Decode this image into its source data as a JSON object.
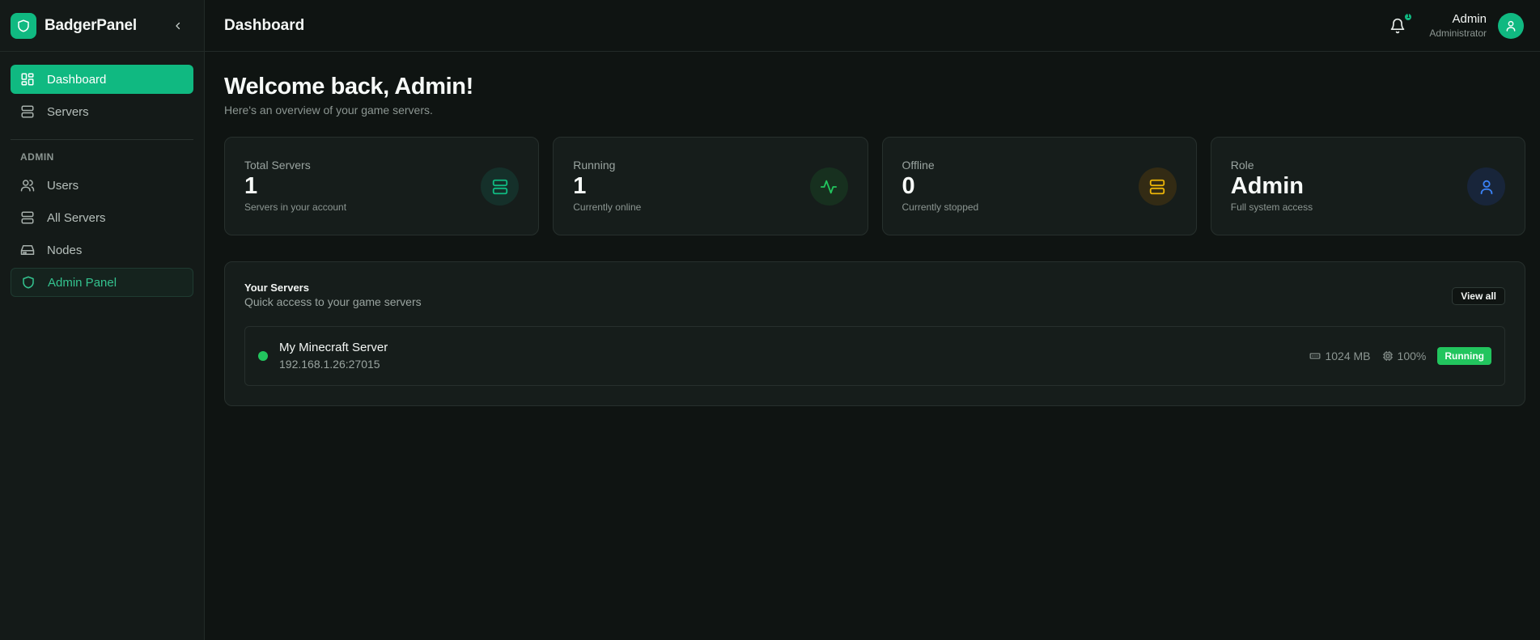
{
  "app": {
    "brand_name": "BadgerPanel",
    "brand_color": "#10b981"
  },
  "sidebar": {
    "items": [
      {
        "label": "Dashboard",
        "icon": "dashboard-icon",
        "active": true
      },
      {
        "label": "Servers",
        "icon": "server-icon",
        "active": false
      }
    ],
    "admin_section_label": "ADMIN",
    "admin_items": [
      {
        "label": "Users",
        "icon": "users-icon"
      },
      {
        "label": "All Servers",
        "icon": "server-icon"
      },
      {
        "label": "Nodes",
        "icon": "hard-drive-icon"
      },
      {
        "label": "Admin Panel",
        "icon": "shield-icon"
      }
    ]
  },
  "header": {
    "title": "Dashboard",
    "user_name": "Admin",
    "user_role": "Administrator",
    "notification_count": "1"
  },
  "main": {
    "welcome_title": "Welcome back, Admin!",
    "welcome_subtitle": "Here's an overview of your game servers.",
    "stats": [
      {
        "label": "Total Servers",
        "value": "1",
        "sub": "Servers in your account",
        "icon": "server-icon",
        "color": "#10b981"
      },
      {
        "label": "Running",
        "value": "1",
        "sub": "Currently online",
        "icon": "activity-icon",
        "color": "#22c55e"
      },
      {
        "label": "Offline",
        "value": "0",
        "sub": "Currently stopped",
        "icon": "server-icon",
        "color": "#eab308"
      },
      {
        "label": "Role",
        "value": "Admin",
        "sub": "Full system access",
        "icon": "user-icon",
        "color": "#3b82f6"
      }
    ],
    "servers_panel": {
      "title": "Your Servers",
      "subtitle": "Quick access to your game servers",
      "view_all_label": "View all",
      "servers": [
        {
          "name": "My Minecraft Server",
          "address": "192.168.1.26:27015",
          "memory": "1024 MB",
          "cpu": "100%",
          "status": "Running"
        }
      ]
    }
  }
}
